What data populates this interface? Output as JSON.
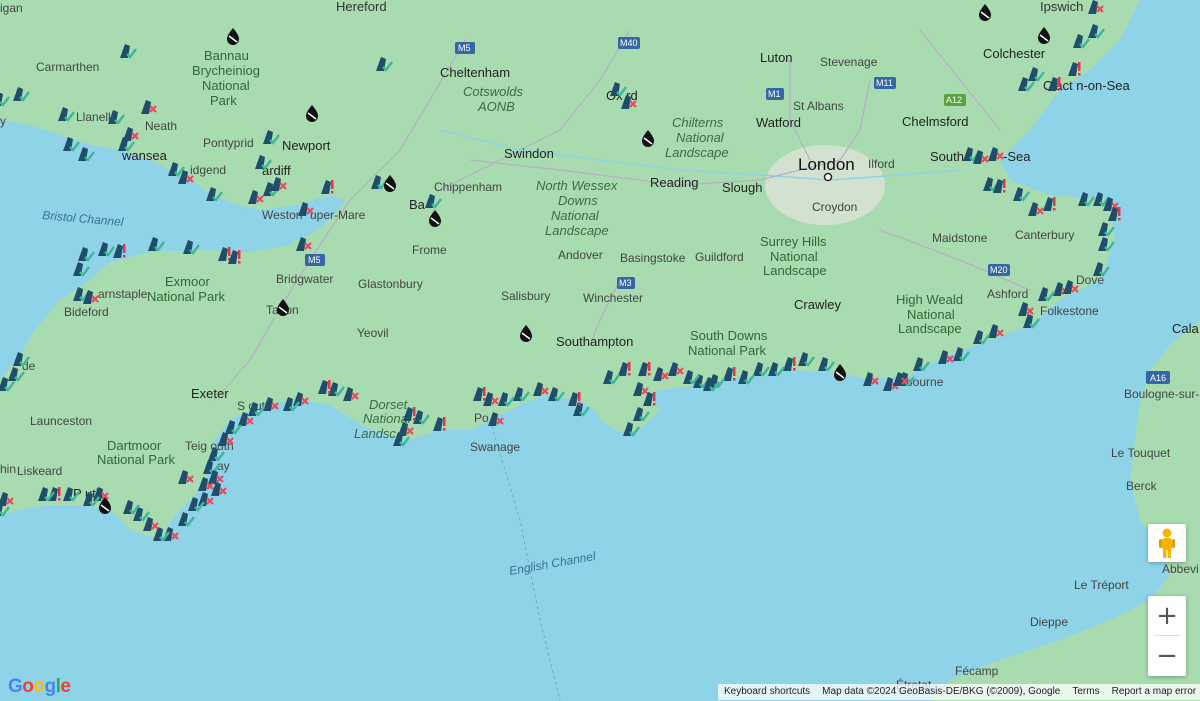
{
  "map": {
    "controls": {
      "street_view_label": "Street View",
      "zoom_in": "+",
      "zoom_out": "−"
    },
    "attribution": {
      "shortcuts": "Keyboard shortcuts",
      "map_data": "Map data ©2024 GeoBasis-DE/BKG (©2009), Google",
      "terms": "Terms",
      "report": "Report a map error"
    },
    "logo": "Google",
    "labels": {
      "london": "London",
      "hereford": "Hereford",
      "ipswich": "Ipswich",
      "carmarthen": "Carmarthen",
      "bannau": "Bannau",
      "brycheiniog": "Brycheiniog",
      "national": "National",
      "park": "Park",
      "cheltenham": "Cheltenham",
      "cotswolds": "Cotswolds",
      "aonb": "AONB",
      "luton": "Luton",
      "stevenage": "Stevenage",
      "colchester": "Colchester",
      "llanelli": "Llanell",
      "neath": "Neath",
      "pontypridd": "Pontyprid",
      "newport": "Newport",
      "oxford": "Ox rd",
      "chilterns": "Chilterns",
      "chilterns_national": "National",
      "chilterns_landscape": "Landscape",
      "watford": "Watford",
      "st_albans": "St Albans",
      "chelmsford": "Chelmsford",
      "clacton": "Clact n-on-Sea",
      "swansea": "wansea",
      "bridgend": "idgend",
      "cardiff": "ardiff",
      "swindon": "Swindon",
      "reading": "Reading",
      "slough": "Slough",
      "ilford": "Ilford",
      "southend": "South",
      "southend_sea": "-Sea",
      "chippenham": "Chippenham",
      "north_wessex": "North Wessex",
      "downs": "Downs",
      "nw_national": "National",
      "nw_landscape": "Landscape",
      "croydon": "Croydon",
      "bristol_channel": "Bristol Channel",
      "weston": "Weston",
      "super_mare": "uper-Mare",
      "bath": "Ba",
      "frome": "Frome",
      "andover": "Andover",
      "basingstoke": "Basingstoke",
      "guildford": "Guildford",
      "surrey_hills": "Surrey Hills",
      "sh_national": "National",
      "sh_landscape": "Landscape",
      "maidstone": "Maidstone",
      "canterbury": "Canterbury",
      "exmoor": "Exmoor",
      "exmoor_park": "National Park",
      "bridgwater": "Bridgwater",
      "glastonbury": "Glastonbury",
      "winchester": "Winchester",
      "crawley": "Crawley",
      "ashford": "Ashford",
      "dover": "Dove",
      "barnstaple": "arnstaple",
      "bideford": "Bideford",
      "taunton": "Ta ton",
      "salisbury": "Salisbury",
      "high_weald": "High Weald",
      "hw_national": "National",
      "hw_landscape": "Landscape",
      "folkestone": "Folkestone",
      "yeovil": "Yeovil",
      "southampton": "Southampton",
      "south_downs": "South Downs",
      "sd_park": "National Park",
      "calais": "Cala",
      "bude": "de",
      "exeter": "Exeter",
      "a16": "A16",
      "boulogne": "Boulogne-sur-Mer",
      "dorset": "Dorset",
      "dorset_national": "National",
      "dorset_landscape": "Landsc",
      "launceston": "Launceston",
      "sidmouth": "S  outh",
      "poole": "Po",
      "swanage": "Swanage",
      "eastbourne": "bourne",
      "dartmoor": "Dartmoor",
      "dartmoor_park": "National Park",
      "teignmouth": "Teig  outh",
      "torbay": "ay",
      "le_touquet": "Le Touquet",
      "liskeard": "Liskeard",
      "plymouth": "P   uth",
      "berck": "Berck",
      "english_channel": "English Channel",
      "abbeville": "Abbevi",
      "le_treport": "Le Tréport",
      "dieppe": "Dieppe",
      "fecamp": "Fécamp",
      "etretat": "Étretat",
      "lin": "hin",
      "gan": "igan",
      "m5": "M5",
      "m40": "M40",
      "m1": "M1",
      "m11": "M11",
      "a12": "A12",
      "m4": "M5",
      "m3": "M3",
      "m20": "M20",
      "ry": "y"
    },
    "colors": {
      "sea": "#8fd3e8",
      "land": "#a8dcb0",
      "land_light": "#c4e8c6",
      "urban": "#e2e4df",
      "marker_dark": "#1f4e6b",
      "check": "#3fb89a",
      "cross": "#e84a5f",
      "alert": "#e8344a"
    },
    "marker_types": [
      "check-marker",
      "cross-marker",
      "alert-marker",
      "nodrop-marker"
    ]
  }
}
